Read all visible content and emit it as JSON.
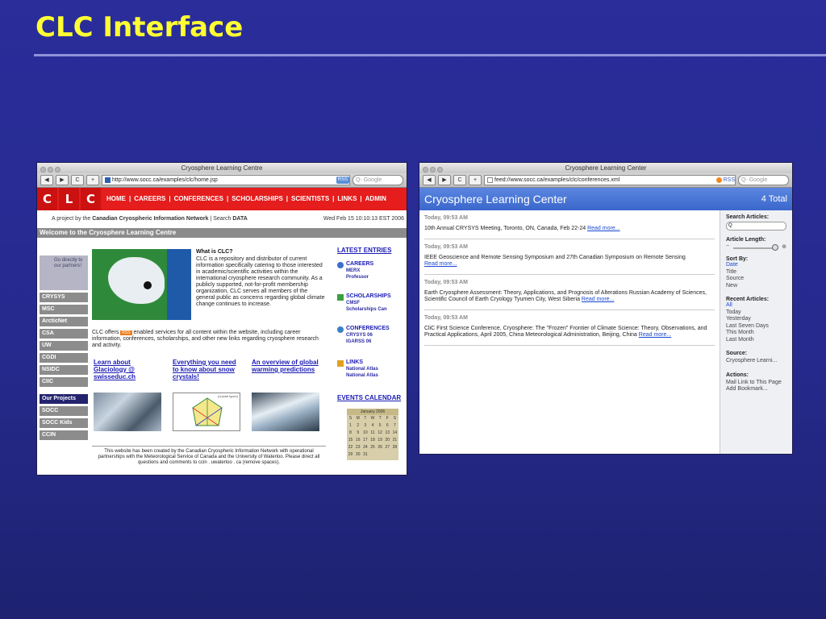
{
  "slide": {
    "title": "CLC Interface"
  },
  "home_window": {
    "title": "Cryosphere Learning Centre",
    "back": "◀",
    "forward": "▶",
    "reload": "C",
    "add": "+",
    "url": "http://www.socc.ca/examples/clc/home.jsp",
    "rss_label": "RSS",
    "search_placeholder": "Q- Google",
    "logo": [
      "C",
      "L",
      "C"
    ],
    "nav": [
      "HOME",
      "|",
      "CAREERS",
      "|",
      "CONFERENCES",
      "|",
      "SCHOLARSHIPS",
      "|",
      "SCIENTISTS",
      "|",
      "LINKS",
      "|",
      "ADMIN"
    ],
    "tagline_prefix": "A project by the ",
    "tagline_org": "Canadian Cryospheric Information Network",
    "tagline_sep": " | Search ",
    "tagline_search": "DATA",
    "date": "Wed Feb 15 10:10:13 EST 2006",
    "welcome": "Welcome to the Cryosphere Learning Centre",
    "partners_text": "Go directly to our partners!",
    "sidebar": [
      "CRYSYS",
      "MSC",
      "ArcticNet",
      "CSA",
      "UW",
      "CGDI",
      "NSIDC",
      "CIIC",
      "Our Projects",
      "SOCC",
      "SOCC Kids",
      "CCIN"
    ],
    "what_title": "What is CLC?",
    "what_body": "CLC is a repository and distributor of current information specifically catering to those interested in academic/scientific activities within the international cryosphere research community. As a publicly supported, not-for-profit membership organization, CLC serves all members of the general public as concerns regarding global climate change continues to increase.",
    "offers_before": "CLC offers ",
    "offers_badge": "RSS",
    "offers_after": " enabled services for all content within the website, including career information, conferences, scholarships, and other new links regarding cryosphere research and activity.",
    "links": [
      "Learn about Glaciology @ swisseduc.ch",
      "Everything you need to know about snow crystals!",
      "An overview of global warming predictions"
    ],
    "diagram_label": "(crystal types)",
    "footer": "This website has been created by the Canadian Cryospheric Information Network with operational partnerships with the Meteorological Service of Canada and the University of Waterloo. Please direct all questions and comments to ccin . uwaterloo . ca (remove spaces).",
    "latest_entries": "LATEST ENTRIES",
    "entries": [
      {
        "title": "CAREERS",
        "sub": [
          "MERX",
          "Professor"
        ]
      },
      {
        "title": "SCHOLARSHIPS",
        "sub": [
          "CMSF",
          "Scholarships Can"
        ]
      },
      {
        "title": "CONFERENCES",
        "sub": [
          "CRYSYS 06",
          "IGARSS 06"
        ]
      },
      {
        "title": "LINKS",
        "sub": [
          "National Atlas",
          "National Atlas"
        ]
      }
    ],
    "events_calendar": "EVENTS CALENDAR",
    "calendar": {
      "month": "January 2006",
      "days": [
        "S",
        "M",
        "T",
        "W",
        "T",
        "F",
        "S"
      ],
      "rows": [
        [
          "1",
          "2",
          "3",
          "4",
          "5",
          "6",
          "7"
        ],
        [
          "8",
          "9",
          "10",
          "11",
          "12",
          "13",
          "14"
        ],
        [
          "15",
          "16",
          "17",
          "18",
          "19",
          "20",
          "21"
        ],
        [
          "22",
          "23",
          "24",
          "25",
          "26",
          "27",
          "28"
        ],
        [
          "29",
          "30",
          "31",
          "",
          "",
          "",
          ""
        ]
      ]
    }
  },
  "feed_window": {
    "title": "Cryosphere Learning Center",
    "back": "◀",
    "forward": "▶",
    "reload": "C",
    "add": "+",
    "url": "feed://www.socc.ca/examples/clc/conferences.xml",
    "rss_label": "RSS",
    "search_placeholder": "Q- Google",
    "header_title": "Cryosphere Learning Center",
    "total": "4 Total",
    "articles": [
      {
        "time": "Today, 09:53 AM",
        "text": "10th Annual CRYSYS Meeting, Toronto, ON, Canada, Feb 22-24 ",
        "more": "Read more..."
      },
      {
        "time": "Today, 09:53 AM",
        "text": "IEEE Geoscience and Remote Sensing Symposium and 27th Canadian Symposium on Remote Sensing ",
        "more": "Read more..."
      },
      {
        "time": "Today, 09:53 AM",
        "text": "Earth Cryosphere Assessment: Theory, Applications, and Prognosis of Alterations Russian Academy of Sciences, Scientific Council of Earth Cryology Tyumen City, West Siberia ",
        "more": "Read more..."
      },
      {
        "time": "Today, 09:53 AM",
        "text": "CliC First Science Conference, Cryosphere: The \"Frozen\" Frontier of Climate Science: Theory, Observations, and Practical Applications, April 2005, China Meteorological Administration, Beijing, China ",
        "more": "Read more..."
      }
    ],
    "sidebar": {
      "search_label": "Search Articles:",
      "search_value": "Q",
      "length_label": "Article Length:",
      "length_minus": "−",
      "length_plus": "⊕",
      "sort_label": "Sort By:",
      "sort_options": [
        "Date",
        "Title",
        "Source",
        "New"
      ],
      "recent_label": "Recent Articles:",
      "recent_options": [
        "All",
        "Today",
        "Yesterday",
        "Last Seven Days",
        "This Month",
        "Last Month"
      ],
      "source_label": "Source:",
      "source_value": "Cryosphere Learni...",
      "actions_label": "Actions:",
      "actions": [
        "Mail Link to This Page",
        "Add Bookmark..."
      ]
    }
  }
}
